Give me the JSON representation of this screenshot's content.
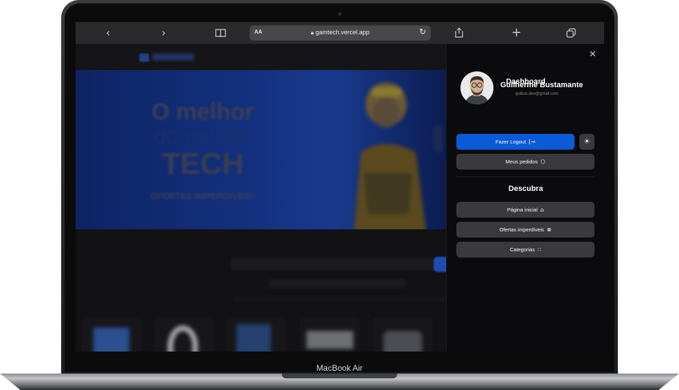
{
  "device": {
    "model_label": "MacBook Air"
  },
  "browser": {
    "url": "gamtech.vercel.app",
    "text_size_label": "AA",
    "icons": {
      "back": "chevron-left-icon",
      "forward": "chevron-right-icon",
      "bookmarks": "book-icon",
      "lock": "lock-icon",
      "reload": "reload-icon",
      "share": "share-icon",
      "new_tab": "plus-icon",
      "tabs": "tabs-icon"
    }
  },
  "hero": {
    "line1": "O melhor",
    "line2": "do mundo",
    "line3": "TECH",
    "line4": "OFERTAS IMPERDÍVEIS!"
  },
  "drawer": {
    "title": "Dashboard",
    "close_icon": "close-icon",
    "user": {
      "name": "Guilherme Bustamante",
      "email": "guibus.dev@gmail.com"
    },
    "logout_label": "Fazer Logout",
    "orders_label": "Meus pedidos",
    "discover_title": "Descubra",
    "nav": [
      {
        "label": "Página inicial",
        "icon": "home-icon"
      },
      {
        "label": "Ofertas imperdíveis",
        "icon": "percent-icon"
      },
      {
        "label": "Categorias",
        "icon": "grid-icon"
      }
    ]
  },
  "colors": {
    "primary": "#0b5bd8",
    "drawer_bg": "#0b0b0d",
    "button_dark": "#3a3a3e"
  }
}
